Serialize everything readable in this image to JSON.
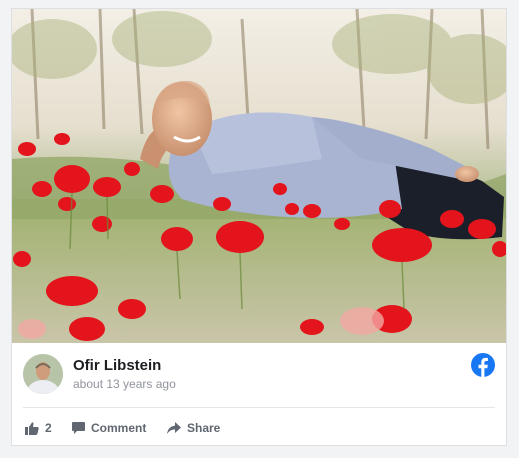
{
  "post": {
    "author_name": "Ofir Libstein",
    "timestamp": "about 13 years ago",
    "photo_description_icon": "man-lying-in-red-poppy-field-photo",
    "brand_icon": "facebook-icon",
    "brand_color": "#1877f2"
  },
  "actions": {
    "like_count": "2",
    "like_icon": "thumbs-up-icon",
    "comment_label": "Comment",
    "comment_icon": "comment-icon",
    "share_label": "Share",
    "share_icon": "share-icon"
  },
  "colors": {
    "text_primary": "#1c1e21",
    "text_secondary": "#90949c",
    "action_text": "#606770",
    "poppy_red": "#e3141c"
  }
}
